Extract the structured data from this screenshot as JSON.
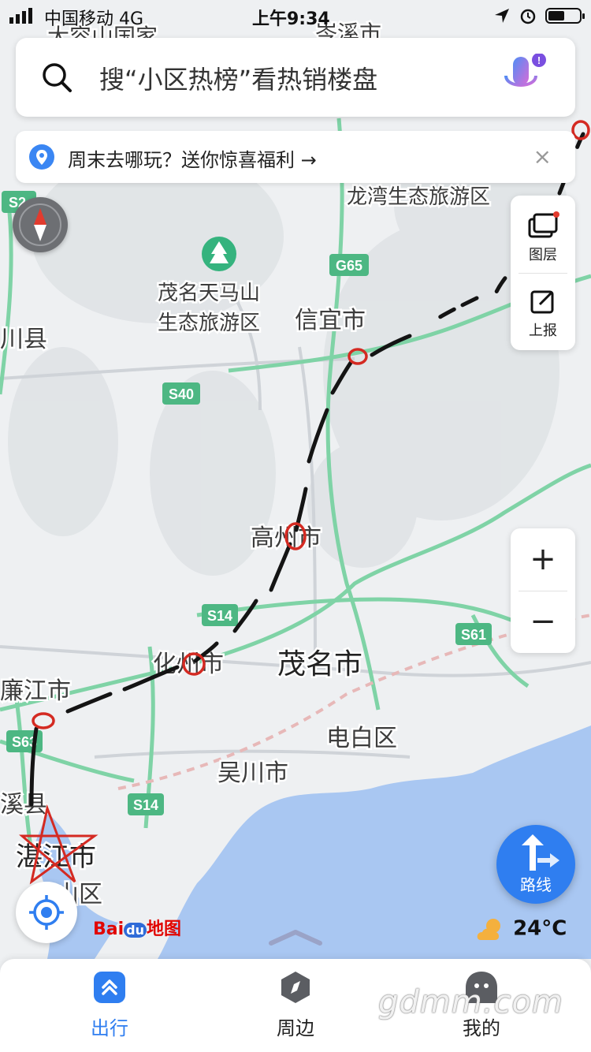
{
  "status_bar": {
    "carrier": "中国移动",
    "network": "4G",
    "time": "上午9:34"
  },
  "search": {
    "placeholder": "搜“小区热榜”看热销楼盘"
  },
  "promo": {
    "text": "周末去哪玩？送你惊喜福利 →",
    "close": "×"
  },
  "layers": {
    "layer_label": "图层",
    "report_label": "上报"
  },
  "zoom": {
    "in": "+",
    "out": "−"
  },
  "route": {
    "label": "路线"
  },
  "logo": {
    "bai": "Bai",
    "du": "du",
    "ditu": "地图"
  },
  "weather": {
    "temp": "24°C"
  },
  "tabs": [
    {
      "label": "出行",
      "icon": "travel-icon",
      "active": true
    },
    {
      "label": "周边",
      "icon": "compass-nav-icon",
      "active": false
    },
    {
      "label": "我的",
      "icon": "profile-icon",
      "active": false
    }
  ],
  "watermark": "gdmm.com",
  "map": {
    "places": [
      {
        "name": "大容山国家",
        "cls": "city"
      },
      {
        "name": "岑溪市",
        "cls": "city"
      },
      {
        "name": "龙湾生态旅游区",
        "cls": "poi"
      },
      {
        "name": "茂名天马山",
        "cls": "poi"
      },
      {
        "name": "生态旅游区",
        "cls": "poi"
      },
      {
        "name": "信宜市",
        "cls": "city"
      },
      {
        "name": "川县",
        "cls": "city"
      },
      {
        "name": "高州市",
        "cls": "city"
      },
      {
        "name": "化州市",
        "cls": "city"
      },
      {
        "name": "茂名市",
        "cls": "major"
      },
      {
        "name": "廉江市",
        "cls": "city"
      },
      {
        "name": "电白区",
        "cls": "city"
      },
      {
        "name": "吴川市",
        "cls": "city"
      },
      {
        "name": "溪县",
        "cls": "city"
      },
      {
        "name": "湛江市",
        "cls": "major"
      },
      {
        "name": "山区",
        "cls": "city"
      }
    ],
    "shields": [
      "S2",
      "G65",
      "S40",
      "S14",
      "S61",
      "S63",
      "S14"
    ],
    "colors": {
      "land": "#eef0f2",
      "sea": "#a9c7f2",
      "road_green": "#7fd3a6",
      "road_gray": "#cfd3d8",
      "route_black": "#141414",
      "mark_red": "#d42a22",
      "accent": "#2f7ef0"
    }
  }
}
